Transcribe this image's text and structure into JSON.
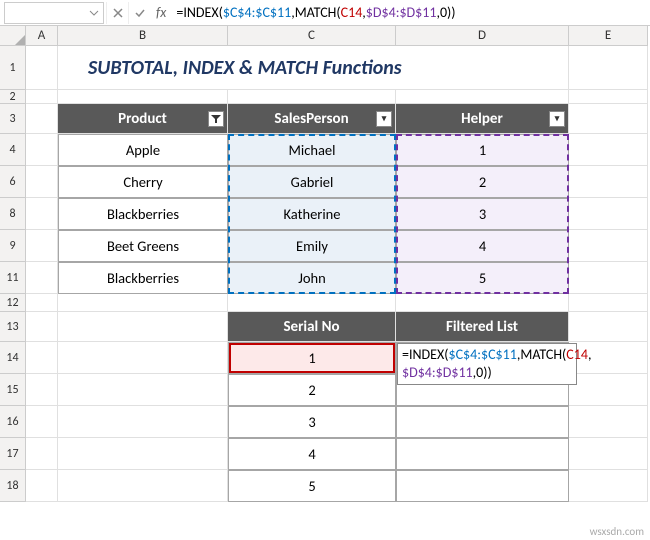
{
  "formulaBar": {
    "nameBox": "",
    "formula": {
      "prefix": "=INDEX(",
      "range1": "$C$4:$C$11",
      "mid1": ",MATCH(",
      "arg": "C14",
      "mid2": ",",
      "range2": "$D$4:$D$11",
      "suffix": ",0))"
    }
  },
  "columns": {
    "A": "A",
    "B": "B",
    "C": "C",
    "D": "D",
    "E": "E"
  },
  "visibleRows": [
    "1",
    "2",
    "3",
    "4",
    "6",
    "8",
    "9",
    "11",
    "12",
    "13",
    "14",
    "15",
    "16",
    "17",
    "18"
  ],
  "title": "SUBTOTAL, INDEX & MATCH Functions",
  "table1": {
    "headers": {
      "product": "Product",
      "sales": "SalesPerson",
      "helper": "Helper"
    },
    "rows": [
      {
        "product": "Apple",
        "sales": "Michael",
        "helper": "1"
      },
      {
        "product": "Cherry",
        "sales": "Gabriel",
        "helper": "2"
      },
      {
        "product": "Blackberries",
        "sales": "Katherine",
        "helper": "3"
      },
      {
        "product": "Beet Greens",
        "sales": "Emily",
        "helper": "4"
      },
      {
        "product": "Blackberries",
        "sales": "John",
        "helper": "5"
      }
    ]
  },
  "table2": {
    "headers": {
      "serial": "Serial No",
      "filtered": "Filtered List"
    },
    "rows": [
      {
        "serial": "1"
      },
      {
        "serial": "2"
      },
      {
        "serial": "3"
      },
      {
        "serial": "4"
      },
      {
        "serial": "5"
      }
    ],
    "editFormula": {
      "prefix": "=INDEX(",
      "range1": "$C$4:$C$11",
      "mid1": ",MATCH(",
      "arg": "C14",
      "mid2": ",",
      "range2": "$D$4:$D$11",
      "suffix": ",0))"
    }
  },
  "watermark": "wsxsdn.com"
}
